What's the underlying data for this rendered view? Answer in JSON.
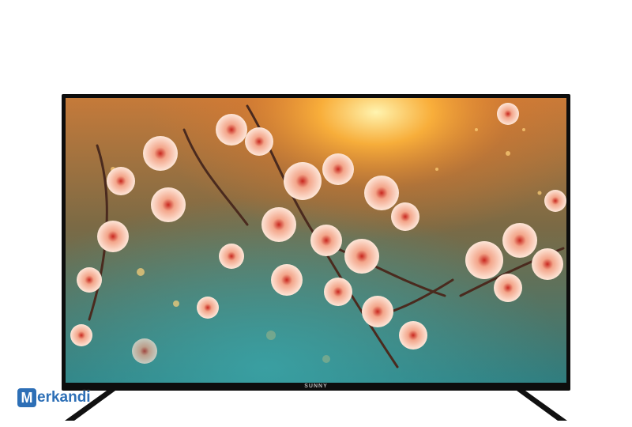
{
  "product": {
    "brand_label": "SUNNY"
  },
  "watermark": {
    "logo_letter": "M",
    "logo_text": "erkandi"
  },
  "colors": {
    "bezel": "#0d0d0d",
    "watermark_blue": "#2d6fb6"
  }
}
